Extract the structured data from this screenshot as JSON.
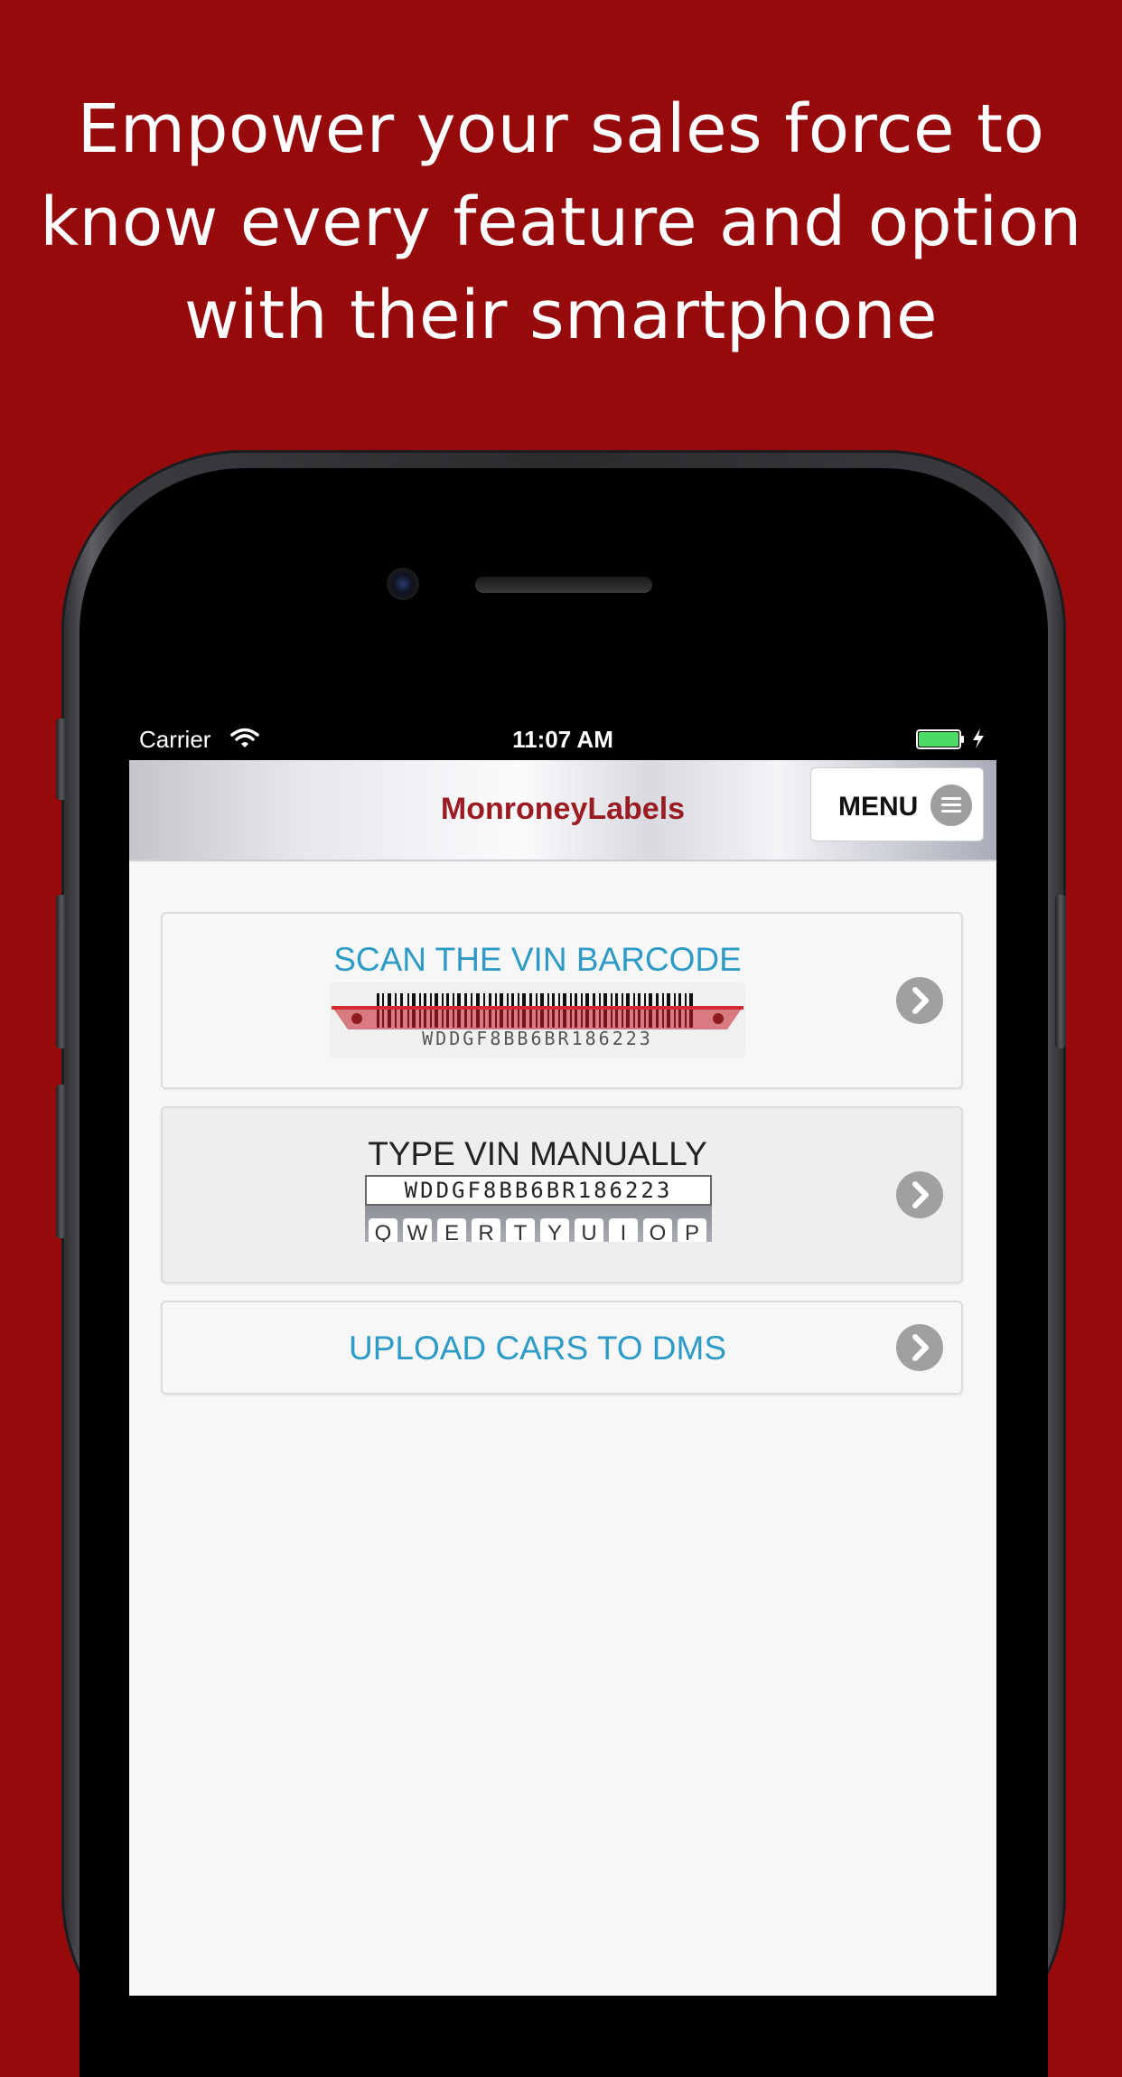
{
  "headline": {
    "line1": "Empower your sales force to",
    "line2": "know every feature and option",
    "line3": "with their smartphone"
  },
  "colors": {
    "background": "#960a0c",
    "brand": "#9b1b22",
    "link_blue": "#2e9bc6",
    "battery": "#4cd964"
  },
  "statusbar": {
    "carrier": "Carrier",
    "time": "11:07 AM",
    "icons": [
      "wifi-icon",
      "battery-icon",
      "bolt-icon"
    ]
  },
  "navbar": {
    "brand": "MonroneyLabels",
    "menu_label": "MENU",
    "menu_icon": "hamburger-icon"
  },
  "actions": [
    {
      "title": "SCAN THE VIN BARCODE",
      "vin": "WDDGF8BB6BR186223",
      "icon": "chevron-right-icon"
    },
    {
      "title": "TYPE VIN MANUALLY",
      "vin": "WDDGF8BB6BR186223",
      "keys": [
        "Q",
        "W",
        "E",
        "R",
        "T",
        "Y",
        "U",
        "I",
        "O",
        "P"
      ],
      "icon": "chevron-right-icon"
    },
    {
      "title": "UPLOAD CARS TO DMS",
      "icon": "chevron-right-icon"
    }
  ]
}
